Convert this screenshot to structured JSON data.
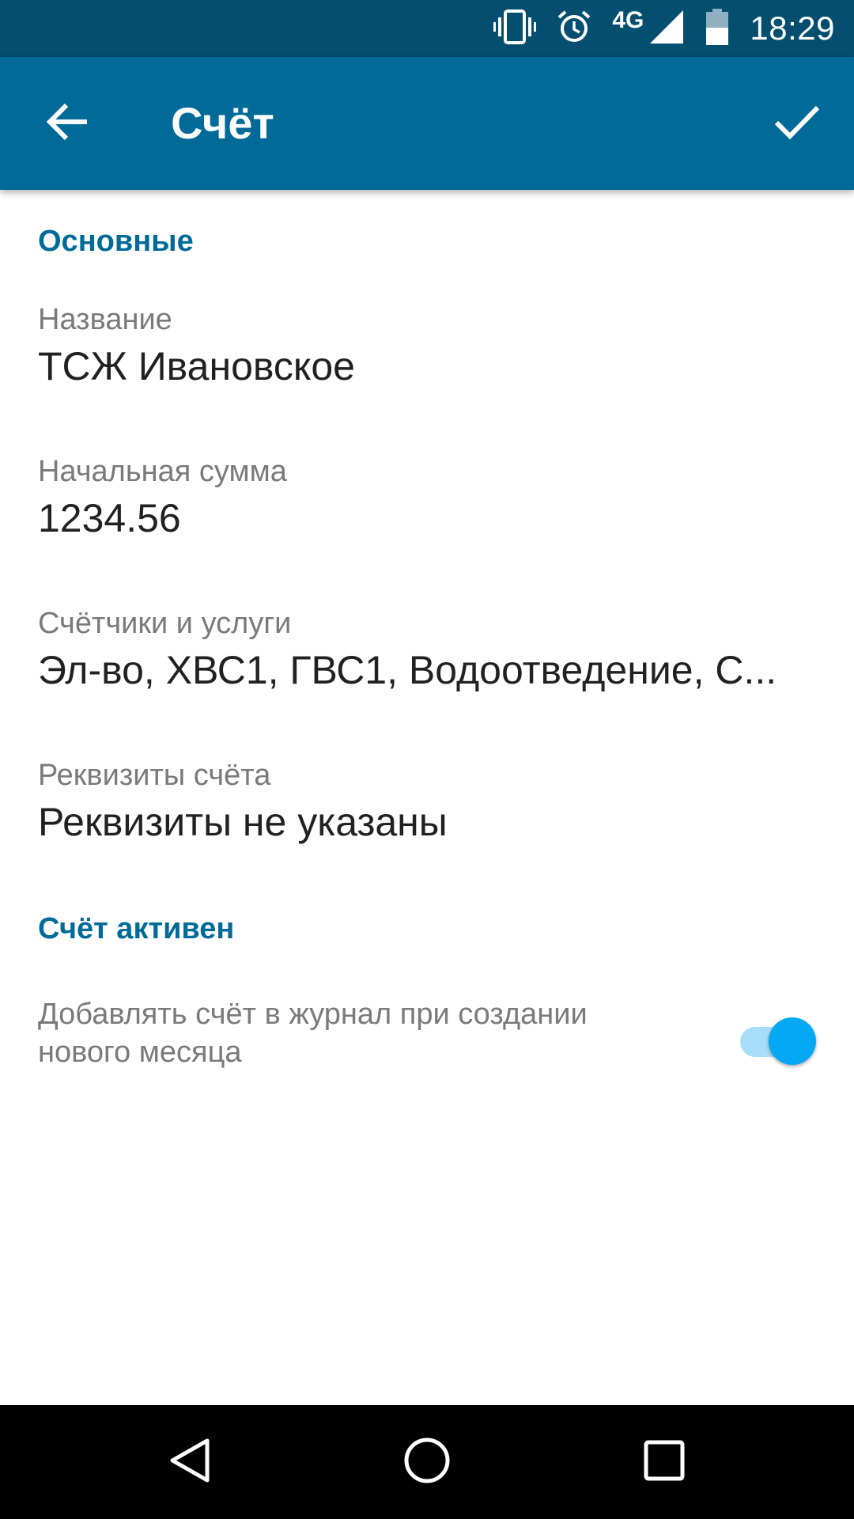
{
  "status_bar": {
    "time": "18:29",
    "network": "4G",
    "icons": [
      "vibrate-icon",
      "alarm-icon",
      "signal-icon",
      "battery-icon"
    ]
  },
  "app_bar": {
    "title": "Счёт",
    "back_icon": "arrow-back-icon",
    "confirm_icon": "check-icon"
  },
  "sections": {
    "main": {
      "header": "Основные",
      "name": {
        "label": "Название",
        "value": "ТСЖ Ивановское"
      },
      "initial_sum": {
        "label": "Начальная сумма",
        "value": "1234.56"
      },
      "meters": {
        "label": "Счётчики и услуги",
        "value": "Эл-во, ХВС1, ГВС1, Водоотведение, С..."
      },
      "requisites": {
        "label": "Реквизиты счёта",
        "value": "Реквизиты не указаны"
      }
    },
    "active": {
      "header": "Счёт активен",
      "add_to_journal": {
        "label_line1": "Добавлять счёт в журнал при создании",
        "label_line2": "нового месяца",
        "checked": true
      }
    }
  },
  "nav_bar": {
    "buttons": [
      "back-triangle-icon",
      "home-circle-icon",
      "recents-square-icon"
    ]
  },
  "colors": {
    "status_bar": "#044e6f",
    "app_bar": "#006a98",
    "accent": "#03a9f4",
    "section_header": "#006a98"
  }
}
